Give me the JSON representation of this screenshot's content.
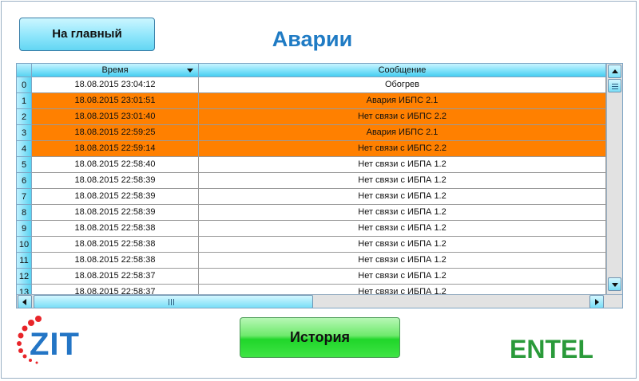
{
  "header": {
    "home_button_label": "На главный",
    "title": "Аварии"
  },
  "table": {
    "columns": [
      "Время",
      "Сообщение"
    ],
    "rows": [
      {
        "num": "0",
        "time": "18.08.2015 23:04:12",
        "message": "Обогрев",
        "alarm": false
      },
      {
        "num": "1",
        "time": "18.08.2015 23:01:51",
        "message": "Авария ИБПС 2.1",
        "alarm": true
      },
      {
        "num": "2",
        "time": "18.08.2015 23:01:40",
        "message": "Нет связи с ИБПС 2.2",
        "alarm": true
      },
      {
        "num": "3",
        "time": "18.08.2015 22:59:25",
        "message": "Авария ИБПС 2.1",
        "alarm": true
      },
      {
        "num": "4",
        "time": "18.08.2015 22:59:14",
        "message": "Нет связи с ИБПС 2.2",
        "alarm": true
      },
      {
        "num": "5",
        "time": "18.08.2015 22:58:40",
        "message": "Нет связи с ИБПА 1.2",
        "alarm": false
      },
      {
        "num": "6",
        "time": "18.08.2015 22:58:39",
        "message": "Нет связи с ИБПА 1.2",
        "alarm": false
      },
      {
        "num": "7",
        "time": "18.08.2015 22:58:39",
        "message": "Нет связи с ИБПА 1.2",
        "alarm": false
      },
      {
        "num": "8",
        "time": "18.08.2015 22:58:39",
        "message": "Нет связи с ИБПА 1.2",
        "alarm": false
      },
      {
        "num": "9",
        "time": "18.08.2015 22:58:38",
        "message": "Нет связи с ИБПА 1.2",
        "alarm": false
      },
      {
        "num": "10",
        "time": "18.08.2015 22:58:38",
        "message": "Нет связи с ИБПА 1.2",
        "alarm": false
      },
      {
        "num": "11",
        "time": "18.08.2015 22:58:38",
        "message": "Нет связи с ИБПА 1.2",
        "alarm": false
      },
      {
        "num": "12",
        "time": "18.08.2015 22:58:37",
        "message": "Нет связи с ИБПА 1.2",
        "alarm": false
      },
      {
        "num": "13",
        "time": "18.08.2015 22:58:37",
        "message": "Нет связи с ИБПА 1.2",
        "alarm": false
      }
    ],
    "alarm_color": "#ff8000"
  },
  "footer": {
    "history_button_label": "История",
    "logo_left": "ZIT",
    "logo_right": "ENTEL"
  },
  "colors": {
    "title": "#1f7bc4",
    "header_accent": "#46cdf0",
    "history_button": "#3fe445",
    "logo_zit": "#2375c5",
    "logo_zit_dots": "#e8252a",
    "logo_entel": "#2a9a3a"
  },
  "icons": [
    "sort-down-icon",
    "scroll-up-icon",
    "scroll-down-icon",
    "scroll-left-icon",
    "scroll-right-icon",
    "scroll-grip-icon"
  ]
}
